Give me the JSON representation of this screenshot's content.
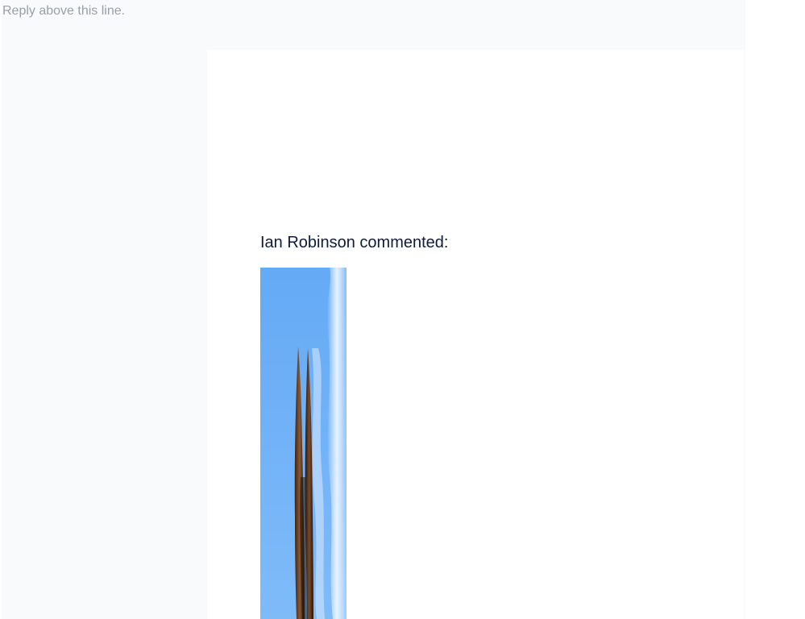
{
  "email": {
    "reply_hint": "Reply above this line.",
    "comment_header": "Ian Robinson commented:",
    "attachment": {
      "icon": "image-thumbnail",
      "subject": "tall spires against blue sky",
      "colors": {
        "sky": "#6aaef6",
        "cloud": "#e8f2ff",
        "spire": "#6b3f22"
      }
    }
  }
}
